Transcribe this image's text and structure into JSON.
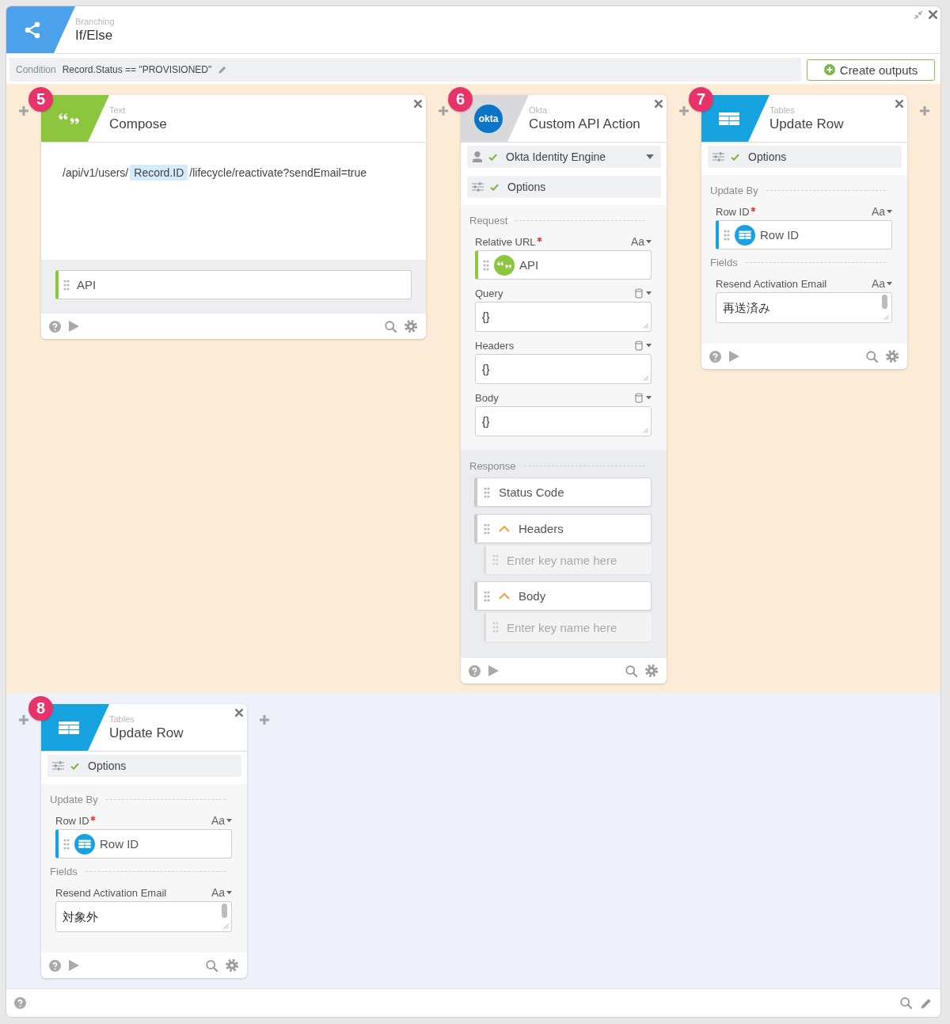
{
  "window": {
    "category": "Branching",
    "title": "If/Else"
  },
  "condition": {
    "label": "Condition",
    "value": "Record.Status == \"PROVISIONED\""
  },
  "create_button": {
    "label": "Create outputs"
  },
  "lanes": [
    {
      "color": "#fcebd6",
      "cards": [
        {
          "step": "5",
          "kind": "text",
          "category": "Text",
          "title": "Compose",
          "sections": [
            {
              "kind": "compose",
              "segments": [
                {
                  "kind": "text",
                  "text": "/api/v1/users/"
                },
                {
                  "kind": "token",
                  "text": "Record.ID"
                },
                {
                  "kind": "text",
                  "text": "/lifecycle/reactivate?sendEmail=true"
                }
              ]
            },
            {
              "kind": "output",
              "value": "API"
            }
          ]
        },
        {
          "step": "6",
          "kind": "okta",
          "category": "Okta",
          "logo": "okta",
          "title": "Custom API Action",
          "sections": [
            {
              "kind": "connection",
              "label": "Okta Identity Engine",
              "valid": true
            },
            {
              "kind": "options",
              "label": "Options",
              "valid": true
            },
            {
              "kind": "inputs",
              "title": "Request",
              "fields": [
                {
                  "kind": "token",
                  "label": "Relative URL",
                  "required": true,
                  "type": {
                    "kind": "text",
                    "label": "Aa"
                  },
                  "token": {
                    "kind": "text",
                    "text": "API"
                  }
                },
                {
                  "kind": "code",
                  "label": "Query",
                  "required": false,
                  "type": {
                    "kind": "object"
                  },
                  "value": "{}"
                },
                {
                  "kind": "code",
                  "label": "Headers",
                  "required": false,
                  "type": {
                    "kind": "object"
                  },
                  "value": "{}"
                },
                {
                  "kind": "code",
                  "label": "Body",
                  "required": false,
                  "type": {
                    "kind": "object"
                  },
                  "value": "{}"
                }
              ]
            },
            {
              "kind": "outputs",
              "title": "Response",
              "items": [
                {
                  "kind": "value",
                  "label": "Status Code"
                },
                {
                  "kind": "object",
                  "label": "Headers",
                  "expanded": true,
                  "children": [
                    {
                      "placeholder": "Enter key name here"
                    }
                  ]
                },
                {
                  "kind": "object",
                  "label": "Body",
                  "expanded": true,
                  "children": [
                    {
                      "placeholder": "Enter key name here"
                    }
                  ]
                }
              ]
            }
          ]
        },
        {
          "step": "7",
          "kind": "tables",
          "category": "Tables",
          "title": "Update Row",
          "sections": [
            {
              "kind": "options",
              "label": "Options",
              "valid": true
            },
            {
              "kind": "inputs",
              "title": "Update By",
              "fields": [
                {
                  "kind": "token",
                  "label": "Row ID",
                  "required": true,
                  "type": {
                    "kind": "text",
                    "label": "Aa"
                  },
                  "token": {
                    "kind": "table",
                    "text": "Row ID"
                  }
                }
              ]
            },
            {
              "kind": "inputs",
              "title": "Fields",
              "fields": [
                {
                  "kind": "textarea",
                  "label": "Resend Activation Email",
                  "required": false,
                  "type": {
                    "kind": "text",
                    "label": "Aa"
                  },
                  "value": "再送済み"
                }
              ]
            }
          ]
        }
      ]
    },
    {
      "color": "#eef0fa",
      "cards": [
        {
          "step": "8",
          "kind": "tables",
          "category": "Tables",
          "title": "Update Row",
          "sections": [
            {
              "kind": "options",
              "label": "Options",
              "valid": true
            },
            {
              "kind": "inputs",
              "title": "Update By",
              "fields": [
                {
                  "kind": "token",
                  "label": "Row ID",
                  "required": true,
                  "type": {
                    "kind": "text",
                    "label": "Aa"
                  },
                  "token": {
                    "kind": "table",
                    "text": "Row ID"
                  }
                }
              ]
            },
            {
              "kind": "inputs",
              "title": "Fields",
              "fields": [
                {
                  "kind": "textarea",
                  "label": "Resend Activation Email",
                  "required": false,
                  "type": {
                    "kind": "text",
                    "label": "Aa"
                  },
                  "value": "対象外"
                }
              ]
            }
          ]
        }
      ]
    }
  ]
}
